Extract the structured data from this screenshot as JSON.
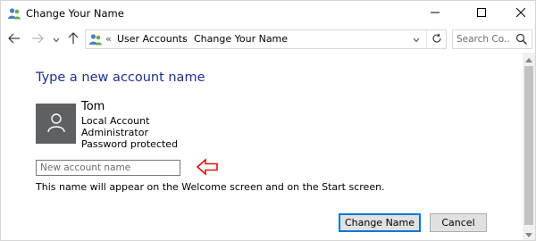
{
  "window": {
    "title": "Change Your Name",
    "icons": {
      "app": "user-accounts-icon",
      "minimize": "minimize-icon",
      "maximize": "maximize-icon",
      "close": "close-icon"
    }
  },
  "navigation": {
    "back_icon": "arrow-left-icon",
    "forward_icon": "arrow-right-icon",
    "recent_icon": "chevron-down-icon",
    "up_icon": "arrow-up-icon"
  },
  "address": {
    "overflow": "«",
    "breadcrumbs": [
      "User Accounts",
      "Change Your Name"
    ],
    "separator": "›",
    "dropdown_icon": "chevron-down-icon",
    "refresh_icon": "refresh-icon"
  },
  "search": {
    "placeholder": "Search Co...",
    "icon": "search-icon"
  },
  "main": {
    "heading": "Type a new account name",
    "user": {
      "avatar_icon": "user-silhouette-icon",
      "name": "Tom",
      "lines": [
        "Local Account",
        "Administrator",
        "Password protected"
      ]
    },
    "name_input": {
      "value": "",
      "placeholder": "New account name"
    },
    "annotation_icon": "red-arrow-left-icon",
    "hint": "This name will appear on the Welcome screen and on the Start screen.",
    "buttons": {
      "primary": "Change Name",
      "cancel": "Cancel"
    }
  },
  "colors": {
    "heading": "#1e3287",
    "avatar_bg": "#5f6062",
    "primary_border": "#0078d7",
    "annotation": "#e01010"
  }
}
